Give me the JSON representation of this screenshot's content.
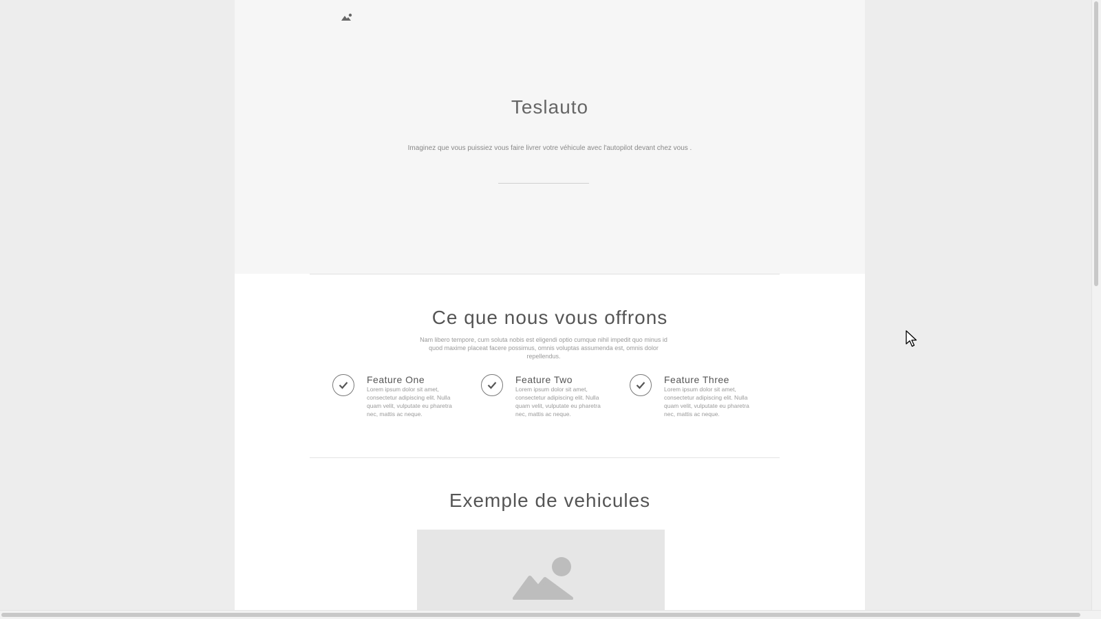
{
  "hero": {
    "title": "Teslauto",
    "subtitle": "Imaginez que vous puissiez vous faire livrer votre véhicule avec l'autopilot devant chez vous ."
  },
  "offers": {
    "title": "Ce que nous vous offrons",
    "text": "Nam libero tempore, cum soluta nobis est eligendi optio cumque nihil impedit quo minus id quod maxime placeat facere possimus, omnis voluptas assumenda est, omnis dolor repellendus.",
    "features": [
      {
        "title": "Feature One",
        "text": "Lorem ipsum dolor sit amet, consectetur adipiscing elit. Nulla quam velit, vulputate eu pharetra nec, mattis ac neque."
      },
      {
        "title": "Feature Two",
        "text": "Lorem ipsum dolor sit amet, consectetur adipiscing elit. Nulla quam velit, vulputate eu pharetra nec, mattis ac neque."
      },
      {
        "title": "Feature Three",
        "text": "Lorem ipsum dolor sit amet, consectetur adipiscing elit. Nulla quam velit, vulputate eu pharetra nec, mattis ac neque."
      }
    ]
  },
  "vehicles": {
    "title": "Exemple de vehicules"
  },
  "icons": {
    "logo": "image-placeholder-icon",
    "feature": "check-circle-icon",
    "vehicle": "image-placeholder-icon",
    "cursor": "mouse-pointer-icon"
  },
  "colors": {
    "background": "#ededed",
    "hero_background": "#f6f6f6",
    "content_background": "#ffffff",
    "image_placeholder": "#e6e6e6",
    "text": "#666666"
  }
}
